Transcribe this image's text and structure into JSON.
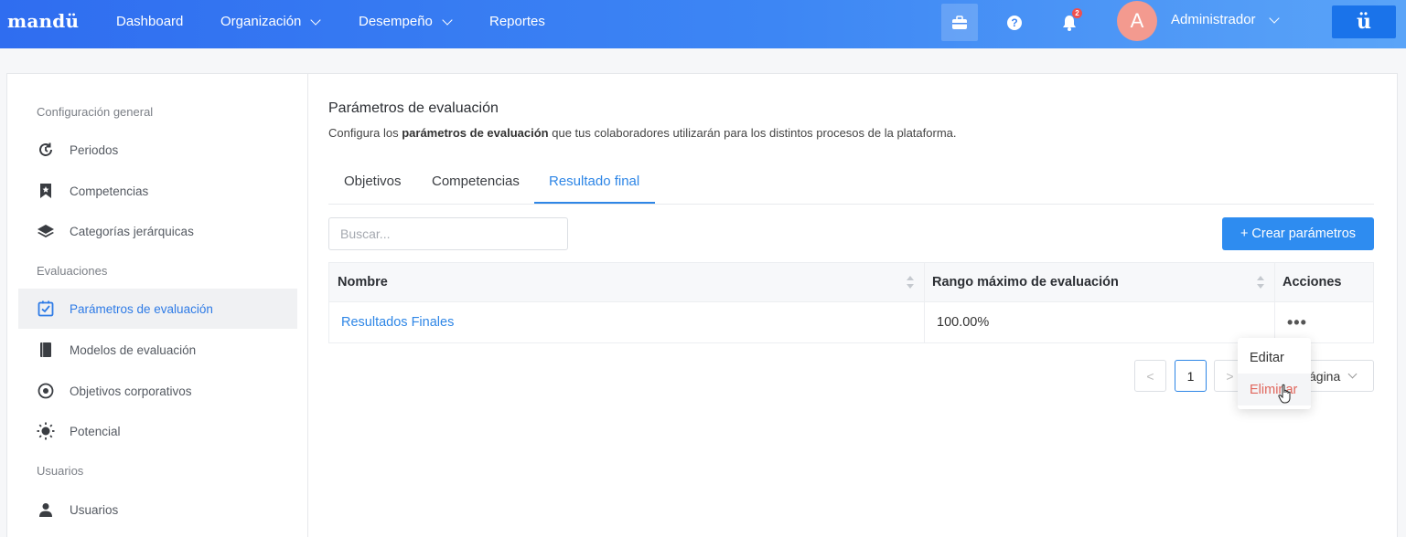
{
  "topbar": {
    "logo": "mandü",
    "nav": [
      {
        "label": "Dashboard"
      },
      {
        "label": "Organización"
      },
      {
        "label": "Desempeño"
      },
      {
        "label": "Reportes"
      }
    ],
    "notifications_count": "2",
    "avatar_letter": "A",
    "user_name": "Administrador",
    "brand_button": "ü",
    "colors": {
      "bar_start": "#2f6df0",
      "bar_end": "#5aa4f8",
      "accent": "#2e86e6",
      "danger": "#e0665c"
    }
  },
  "sidebar": {
    "sections": [
      {
        "title": "Configuración general"
      },
      {
        "title": "Evaluaciones"
      },
      {
        "title": "Usuarios"
      }
    ],
    "items": [
      {
        "label": "Periodos",
        "icon": "history-icon"
      },
      {
        "label": "Competencias",
        "icon": "bookmark-icon"
      },
      {
        "label": "Categorías jerárquicas",
        "icon": "layers-icon"
      },
      {
        "label": "Parámetros de evaluación",
        "icon": "checkbox-icon",
        "active": true
      },
      {
        "label": "Modelos de evaluación",
        "icon": "book-icon"
      },
      {
        "label": "Objetivos corporativos",
        "icon": "target-icon"
      },
      {
        "label": "Potencial",
        "icon": "sun-icon"
      },
      {
        "label": "Usuarios",
        "icon": "user-icon"
      }
    ]
  },
  "main": {
    "title": "Parámetros de evaluación",
    "desc_prefix": "Configura los ",
    "desc_bold": "parámetros de evaluación",
    "desc_suffix": " que tus colaboradores utilizarán para los distintos procesos de la plataforma.",
    "tabs": [
      {
        "label": "Objetivos"
      },
      {
        "label": "Competencias"
      },
      {
        "label": "Resultado final",
        "active": true
      }
    ],
    "search_placeholder": "Buscar...",
    "create_button": "+ Crear parámetros",
    "table": {
      "columns": [
        "Nombre",
        "Rango máximo de evaluación",
        "Acciones"
      ],
      "rows": [
        {
          "nombre": "Resultados Finales",
          "rango": "100.00%",
          "acciones": "•••"
        }
      ]
    },
    "pagination": {
      "prev": "<",
      "current": "1",
      "next": ">",
      "per_page": "ágina"
    },
    "actions_menu": {
      "items": [
        "Editar",
        "Eliminar"
      ]
    }
  }
}
